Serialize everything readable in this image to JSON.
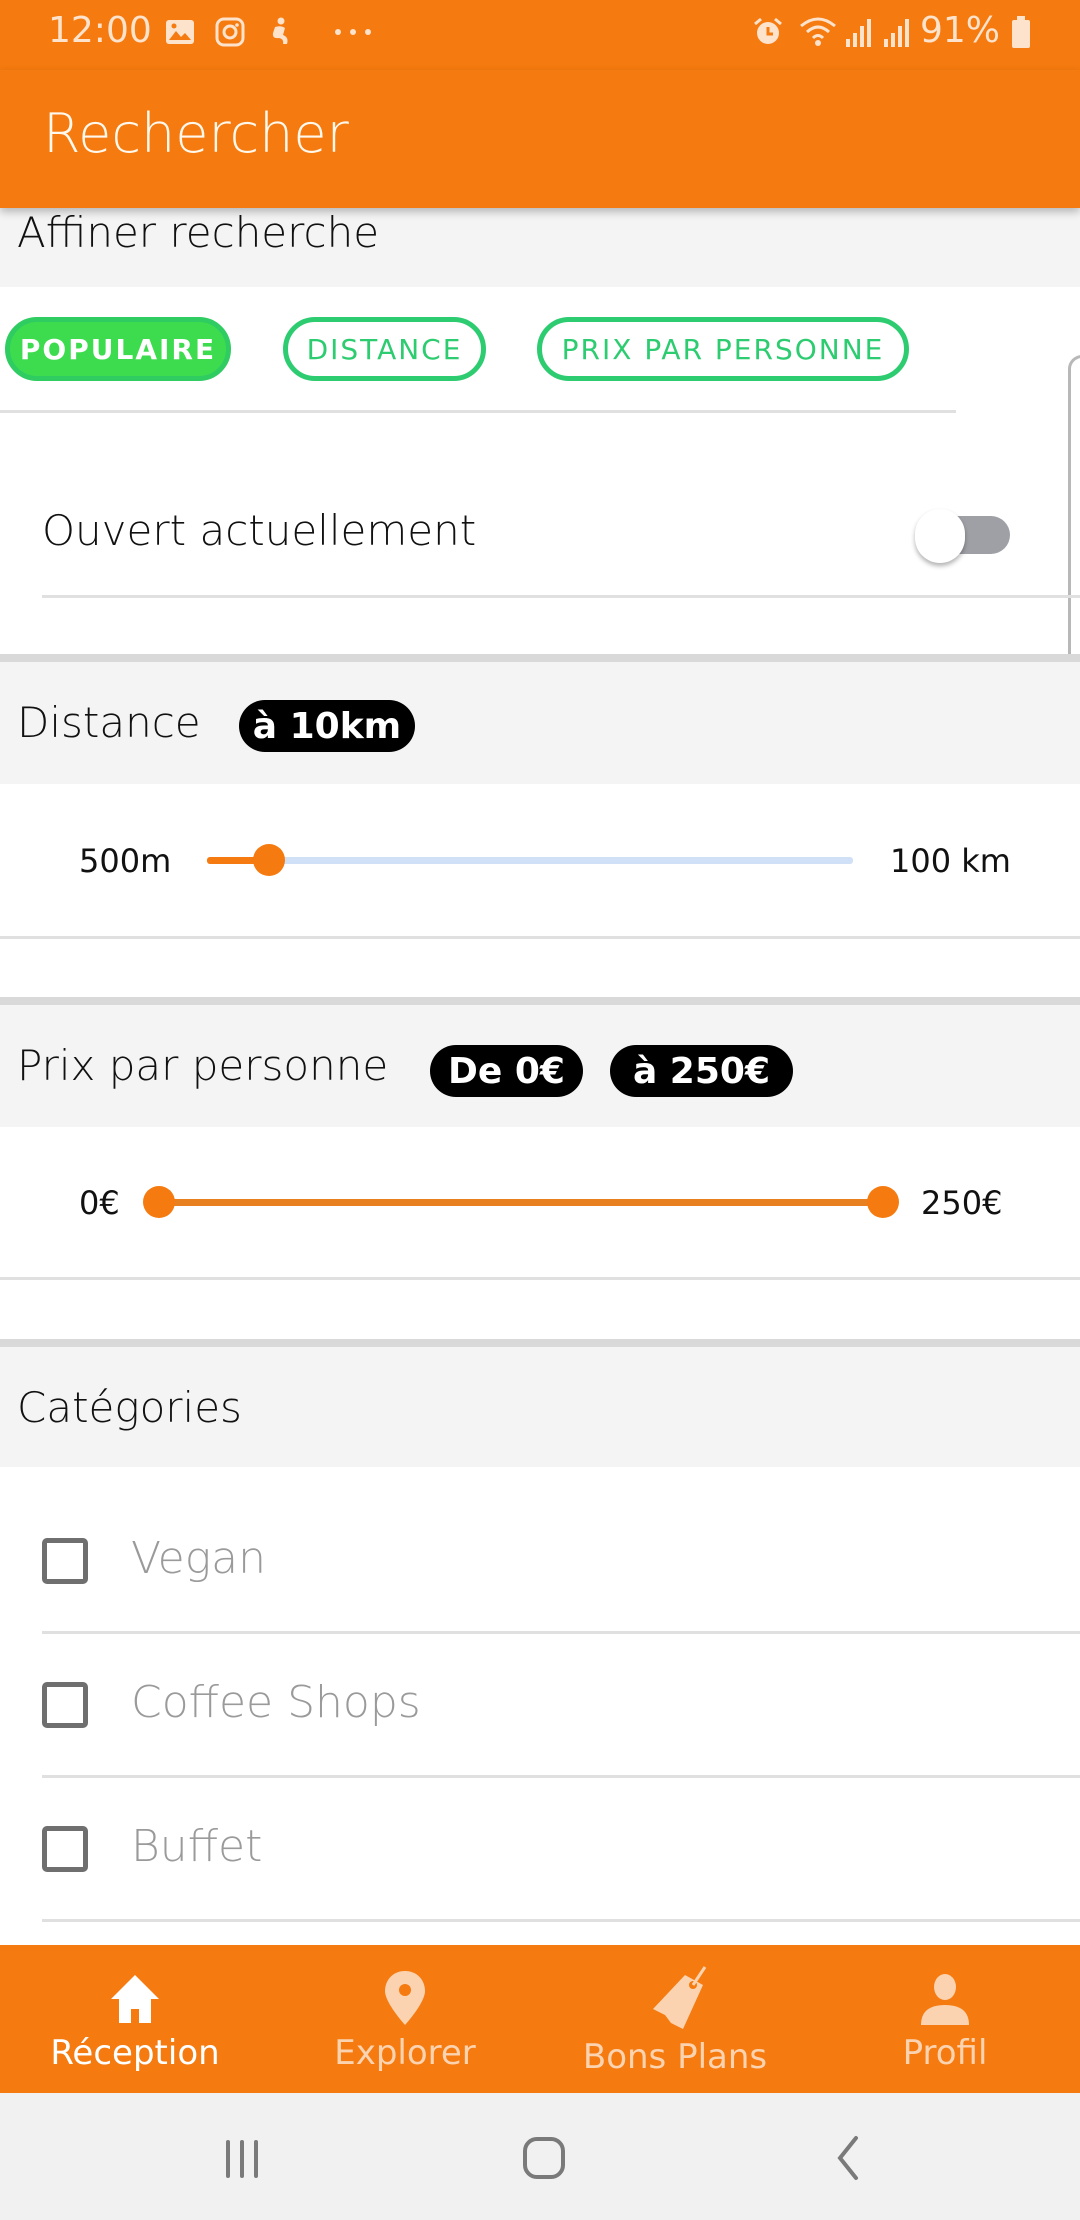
{
  "status_bar": {
    "time": "12:00",
    "left_icons": [
      "gallery-icon",
      "instagram-icon",
      "accessibility-icon",
      "more-dots-icon"
    ],
    "right_icons": [
      "alarm-icon",
      "wifi-icon",
      "signal-icon",
      "signal-icon"
    ],
    "battery": "91%"
  },
  "app_bar": {
    "title": "Rechercher"
  },
  "refine": {
    "header": "Affiner recherche",
    "sort_chips": [
      {
        "label": "POPULAIRE",
        "active": true
      },
      {
        "label": "DISTANCE",
        "active": false
      },
      {
        "label": "PRIX PAR PERSONNE",
        "active": false
      }
    ],
    "open_now": {
      "label": "Ouvert actuellement",
      "enabled": false
    }
  },
  "distance": {
    "header": "Distance",
    "badge": "à 10km",
    "min_label": "500m",
    "max_label": "100 km",
    "min_km": 0.5,
    "max_km": 100,
    "value_km": 10
  },
  "price": {
    "header": "Prix par personne",
    "badge_from": "De 0€",
    "badge_to": "à 250€",
    "min_label": "0€",
    "max_label": "250€",
    "min": 0,
    "max": 250,
    "low": 0,
    "high": 250
  },
  "categories": {
    "header": "Catégories",
    "items": [
      {
        "label": "Vegan",
        "checked": false
      },
      {
        "label": "Coffee Shops",
        "checked": false
      },
      {
        "label": "Buffet",
        "checked": false
      }
    ]
  },
  "bottom_nav": {
    "items": [
      {
        "label": "Réception",
        "icon": "home-icon",
        "active": true
      },
      {
        "label": "Explorer",
        "icon": "map-pin-icon",
        "active": false
      },
      {
        "label": "Bons Plans",
        "icon": "tag-icon",
        "active": false
      },
      {
        "label": "Profil",
        "icon": "user-icon",
        "active": false
      }
    ]
  },
  "colors": {
    "brand_orange": "#f57a0f",
    "chip_green": "#2ecc71",
    "slider_inactive": "#cfe0f7"
  }
}
